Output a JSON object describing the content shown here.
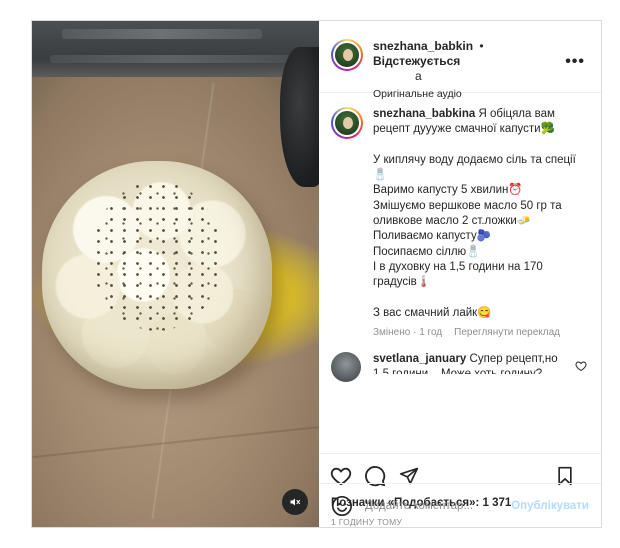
{
  "post": {
    "username": "snezhana_babkin",
    "username_wrap": "a",
    "separator": "•",
    "follow_label": "Відстежується",
    "audio_label": "Оригінальне аудіо",
    "more_label": "•••"
  },
  "caption": {
    "author": "snezhana_babkina",
    "text": " Я обіцяла вам рецепт дуууже смачної капусти🥦\n\nУ киплячу воду додаємо сіль та спеції🧂\nВаримо капусту 5 хвилин⏰\nЗмішуємо вершкове масло 50 гр та оливкове масло 2 ст.ложки🧈\nПоливаємо капусту🫐\nПосипаємо сіллю🧂\nІ в духовку на 1,5 години на 170 градусів🌡️\n\nЗ вас смачний лайк😋",
    "edited_label": "Змінено · 1 год",
    "translate_label": "Переглянути переклад"
  },
  "comment": {
    "author": "svetlana_january",
    "text": " Супер рецепт,но 1,5 години... Може хоть годину?"
  },
  "likes": {
    "label": "Позначки «Подобається»: ",
    "count": "1 371"
  },
  "time_label": "1 ГОДИНУ ТОМУ",
  "add_comment": {
    "placeholder": "Додайте коментар...",
    "post_label": "Опублікувати"
  },
  "colors": {
    "accent_disabled": "#b3dbff",
    "secondary_text": "#8e8e8e",
    "primary_text": "#262626"
  }
}
